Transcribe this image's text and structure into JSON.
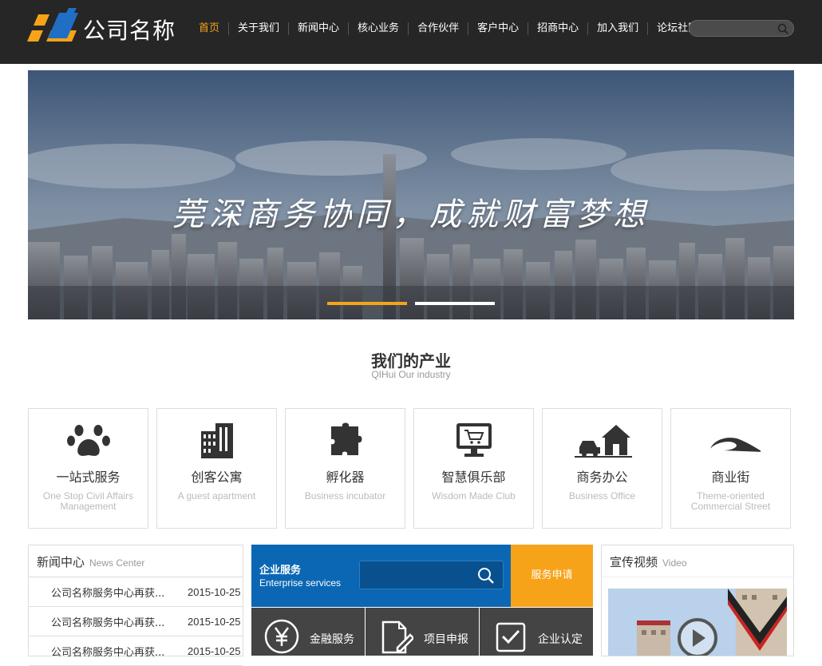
{
  "brand": {
    "name": "公司名称",
    "accent": "#f7a319",
    "blue": "#0b67b4"
  },
  "nav": [
    {
      "label": "首页",
      "active": true
    },
    {
      "label": "关于我们"
    },
    {
      "label": "新闻中心"
    },
    {
      "label": "核心业务"
    },
    {
      "label": "合作伙伴"
    },
    {
      "label": "客户中心"
    },
    {
      "label": "招商中心"
    },
    {
      "label": "加入我们"
    },
    {
      "label": "论坛社区"
    }
  ],
  "search": {
    "placeholder": ""
  },
  "banner": {
    "slogan": "莞深商务协同，成就财富梦想",
    "slides": 2,
    "active_slide": 1
  },
  "industry": {
    "title": "我们的产业",
    "subtitle": "QIHui Our industry",
    "cards": [
      {
        "title": "一站式服务",
        "subtitle": "One Stop Civil Affairs Management",
        "icon": "paw-icon"
      },
      {
        "title": "创客公寓",
        "subtitle": "A guest apartment",
        "icon": "building-icon"
      },
      {
        "title": "孵化器",
        "subtitle": "Business incubator",
        "icon": "puzzle-icon"
      },
      {
        "title": "智慧俱乐部",
        "subtitle": "Wisdom Made Club",
        "icon": "monitor-cart-icon"
      },
      {
        "title": "商务办公",
        "subtitle": "Business Office",
        "icon": "house-car-icon"
      },
      {
        "title": "商业街",
        "subtitle": "Theme-oriented Commercial Street",
        "icon": "road-icon"
      }
    ]
  },
  "news": {
    "title": "新闻中心",
    "title_en": "News Center",
    "items": [
      {
        "title": "公司名称服务中心再获...",
        "date": "2015-10-25"
      },
      {
        "title": "公司名称服务中心再获...",
        "date": "2015-10-25"
      },
      {
        "title": "公司名称服务中心再获...",
        "date": "2015-10-25"
      }
    ]
  },
  "enterprise": {
    "title": "企业服务",
    "title_en": "Enterprise services",
    "search_placeholder": "",
    "apply_label": "服务申请",
    "services": [
      {
        "label": "金融服务",
        "icon": "yen-icon"
      },
      {
        "label": "项目申报",
        "icon": "document-pen-icon"
      },
      {
        "label": "企业认定",
        "icon": "check-icon"
      }
    ]
  },
  "video": {
    "title": "宣传视频",
    "title_en": "Video"
  }
}
